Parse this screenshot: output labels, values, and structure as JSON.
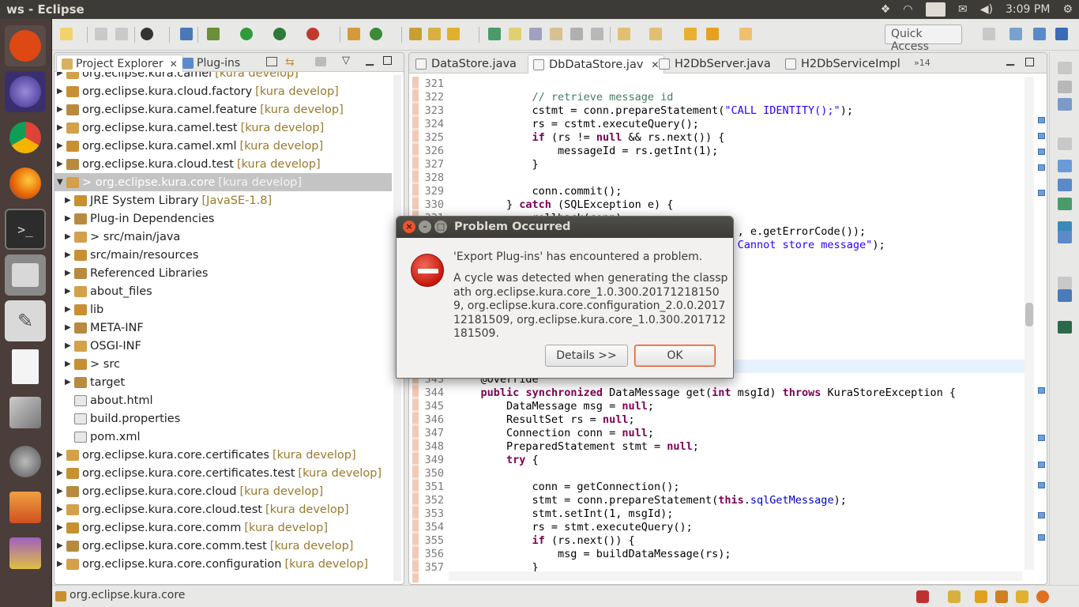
{
  "window": {
    "title": "ws - Eclipse"
  },
  "tray": {
    "keyboard": "En",
    "time": "3:09 PM"
  },
  "toolbar": {
    "quick_access": "Quick Access"
  },
  "left_panel": {
    "tabs": [
      {
        "label": "Project Explorer"
      },
      {
        "label": "Plug-ins"
      }
    ],
    "tree": [
      {
        "label": "org.eclipse.kura.camel",
        "dec": "[kura develop]",
        "indent": 0
      },
      {
        "label": "org.eclipse.kura.cloud.factory",
        "dec": "[kura develop]",
        "indent": 0
      },
      {
        "label": "org.eclipse.kura.camel.feature",
        "dec": "[kura develop]",
        "indent": 0
      },
      {
        "label": "org.eclipse.kura.camel.test",
        "dec": "[kura develop]",
        "indent": 0
      },
      {
        "label": "org.eclipse.kura.camel.xml",
        "dec": "[kura develop]",
        "indent": 0
      },
      {
        "label": "org.eclipse.kura.cloud.test",
        "dec": "[kura develop]",
        "indent": 0
      },
      {
        "label": "> org.eclipse.kura.core",
        "dec": "[kura develop]",
        "indent": 0,
        "selected": true
      },
      {
        "label": "JRE System Library",
        "dec": "[JavaSE-1.8]",
        "indent": 1
      },
      {
        "label": "Plug-in Dependencies",
        "dec": "",
        "indent": 1
      },
      {
        "label": "> src/main/java",
        "dec": "",
        "indent": 1
      },
      {
        "label": "src/main/resources",
        "dec": "",
        "indent": 1
      },
      {
        "label": "Referenced Libraries",
        "dec": "",
        "indent": 1
      },
      {
        "label": "about_files",
        "dec": "",
        "indent": 1
      },
      {
        "label": "lib",
        "dec": "",
        "indent": 1
      },
      {
        "label": "META-INF",
        "dec": "",
        "indent": 1
      },
      {
        "label": "OSGI-INF",
        "dec": "",
        "indent": 1
      },
      {
        "label": "> src",
        "dec": "",
        "indent": 1
      },
      {
        "label": "target",
        "dec": "",
        "indent": 1
      },
      {
        "label": "about.html",
        "dec": "",
        "indent": 1,
        "leaf": true
      },
      {
        "label": "build.properties",
        "dec": "",
        "indent": 1,
        "leaf": true
      },
      {
        "label": "pom.xml",
        "dec": "",
        "indent": 1,
        "leaf": true
      },
      {
        "label": "org.eclipse.kura.core.certificates",
        "dec": "[kura develop]",
        "indent": 0
      },
      {
        "label": "org.eclipse.kura.core.certificates.test",
        "dec": "[kura develop]",
        "indent": 0
      },
      {
        "label": "org.eclipse.kura.core.cloud",
        "dec": "[kura develop]",
        "indent": 0
      },
      {
        "label": "org.eclipse.kura.core.cloud.test",
        "dec": "[kura develop]",
        "indent": 0
      },
      {
        "label": "org.eclipse.kura.core.comm",
        "dec": "[kura develop]",
        "indent": 0
      },
      {
        "label": "org.eclipse.kura.core.comm.test",
        "dec": "[kura develop]",
        "indent": 0
      },
      {
        "label": "org.eclipse.kura.core.configuration",
        "dec": "[kura develop]",
        "indent": 0
      }
    ]
  },
  "editor": {
    "tabs": [
      {
        "label": "DataStore.java"
      },
      {
        "label": "DbDataStore.jav"
      },
      {
        "label": "H2DbServer.java"
      },
      {
        "label": "H2DbServiceImpl"
      }
    ],
    "overflow_count": "»14",
    "lines": [
      {
        "n": "321",
        "code": ""
      },
      {
        "n": "322",
        "code": "            <span class=\"cmt\">// retrieve message id</span>"
      },
      {
        "n": "323",
        "code": "            cstmt = conn.prepareStatement(<span class=\"str\">\"CALL IDENTITY();\"</span>);"
      },
      {
        "n": "324",
        "code": "            rs = cstmt.executeQuery();"
      },
      {
        "n": "325",
        "code": "            <span class=\"kw\">if</span> (rs != <span class=\"kw\">null</span> &amp;&amp; rs.next()) {"
      },
      {
        "n": "326",
        "code": "                messageId = rs.getInt(1);"
      },
      {
        "n": "327",
        "code": "            }"
      },
      {
        "n": "328",
        "code": ""
      },
      {
        "n": "329",
        "code": "            conn.commit();"
      },
      {
        "n": "330",
        "code": "        } <span class=\"kw\">catch</span> (SQLException e) {"
      },
      {
        "n": "331",
        "code": "            rollback(conn);"
      },
      {
        "n": "332",
        "code": "                                            , e.getErrorCode());"
      },
      {
        "n": "333",
        "code": "                                            <span class=\"str\">Cannot store message\"</span>);"
      },
      {
        "n": "334",
        "code": ""
      },
      {
        "n": "335",
        "code": ""
      },
      {
        "n": "336",
        "code": ""
      },
      {
        "n": "337",
        "code": ""
      },
      {
        "n": "338",
        "code": ""
      },
      {
        "n": "339",
        "code": ""
      },
      {
        "n": "340",
        "code": ""
      },
      {
        "n": "341",
        "code": ""
      },
      {
        "n": "342",
        "code": ""
      },
      {
        "n": "343",
        "code": "    @Override"
      },
      {
        "n": "344",
        "code": "    <span class=\"kw\">public</span> <span class=\"kw\">synchronized</span> DataMessage get(<span class=\"kw\">int</span> msgId) <span class=\"kw\">throws</span> KuraStoreException {"
      },
      {
        "n": "345",
        "code": "        DataMessage msg = <span class=\"kw\">null</span>;"
      },
      {
        "n": "346",
        "code": "        ResultSet rs = <span class=\"kw\">null</span>;"
      },
      {
        "n": "347",
        "code": "        Connection conn = <span class=\"kw\">null</span>;"
      },
      {
        "n": "348",
        "code": "        PreparedStatement stmt = <span class=\"kw\">null</span>;"
      },
      {
        "n": "349",
        "code": "        <span class=\"kw\">try</span> {"
      },
      {
        "n": "350",
        "code": ""
      },
      {
        "n": "351",
        "code": "            conn = getConnection();"
      },
      {
        "n": "352",
        "code": "            stmt = conn.prepareStatement(<span class=\"kw\">this</span>.<span class=\"fld\">sqlGetMessage</span>);"
      },
      {
        "n": "353",
        "code": "            stmt.setInt(1, msgId);"
      },
      {
        "n": "354",
        "code": "            rs = stmt.executeQuery();"
      },
      {
        "n": "355",
        "code": "            <span class=\"kw\">if</span> (rs.next()) {"
      },
      {
        "n": "356",
        "code": "                msg = buildDataMessage(rs);"
      },
      {
        "n": "357",
        "code": "            }"
      }
    ]
  },
  "status": {
    "text": "org.eclipse.kura.core"
  },
  "dialog": {
    "title": "Problem Occurred",
    "message": "'Export Plug-ins' has encountered a problem.",
    "detail": "A cycle was detected when generating the classpath org.eclipse.kura.core_1.0.300.201712181509, org.eclipse.kura.core.configuration_2.0.0.201712181509, org.eclipse.kura.core_1.0.300.201712181509.",
    "details_label": "Details >>",
    "ok_label": "OK"
  }
}
